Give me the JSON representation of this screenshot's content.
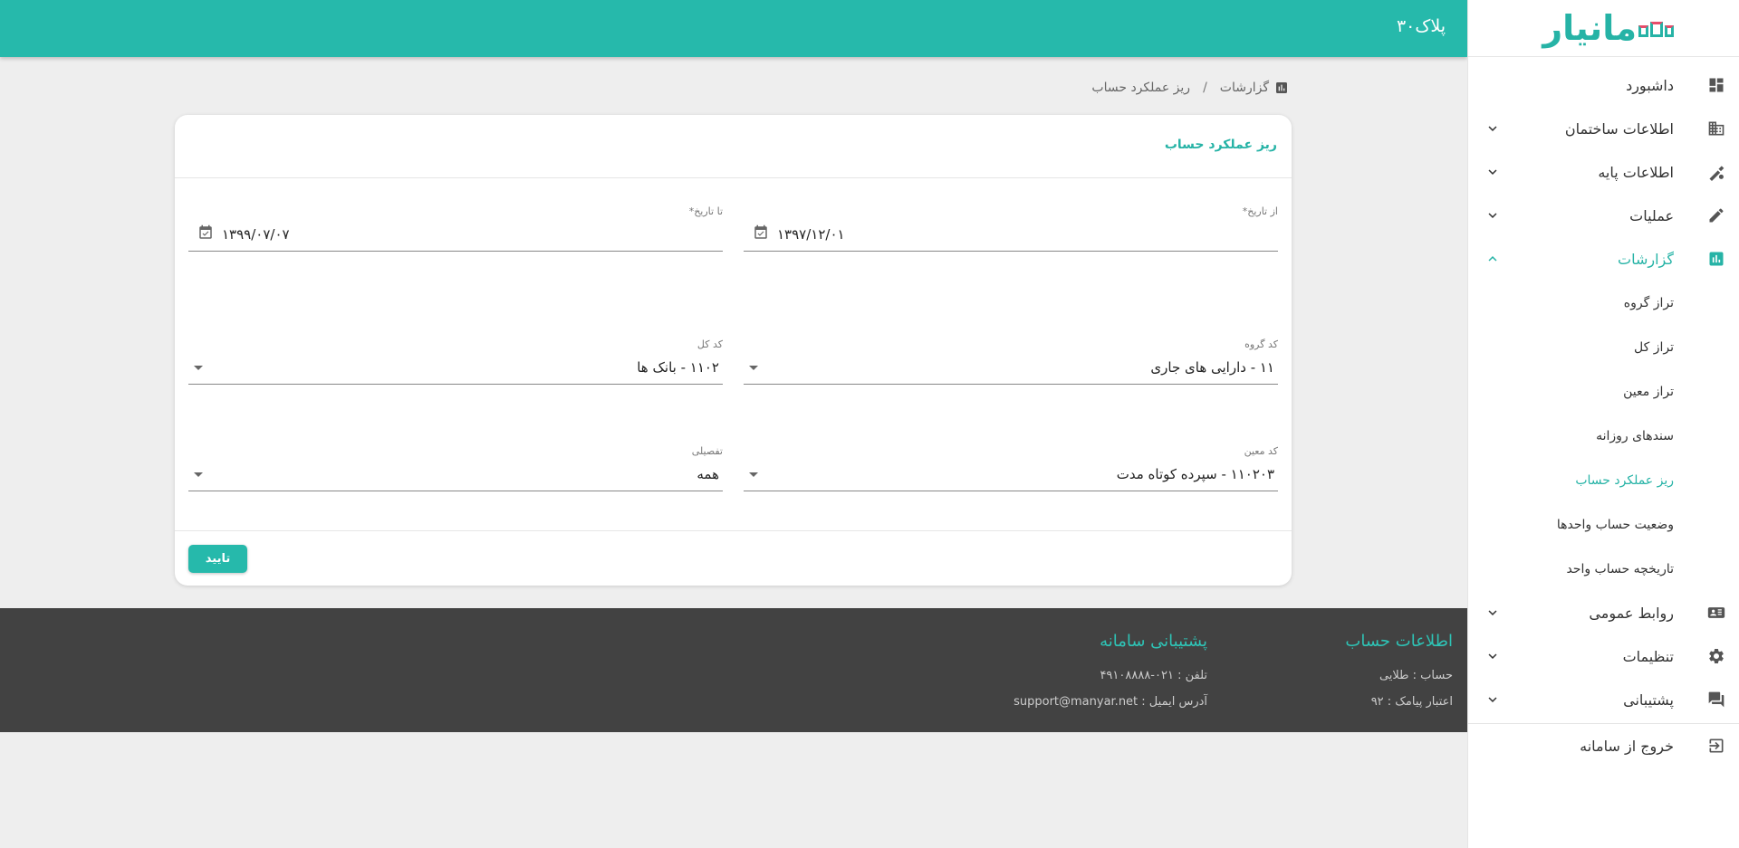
{
  "brand": {
    "logo_text": "مانیار"
  },
  "header": {
    "title": "پلاک۳۰"
  },
  "sidebar": {
    "items": [
      {
        "label": "داشبورد",
        "icon": "dashboard-icon"
      },
      {
        "label": "اطلاعات ساختمان",
        "icon": "building-icon"
      },
      {
        "label": "اطلاعات پایه",
        "icon": "base-info-icon"
      },
      {
        "label": "عملیات",
        "icon": "pencil-icon"
      },
      {
        "label": "گزارشات",
        "icon": "report-icon",
        "expanded": true
      },
      {
        "label": "روابط عمومی",
        "icon": "contact-card-icon"
      },
      {
        "label": "تنظیمات",
        "icon": "gear-icon"
      },
      {
        "label": "پشتیبانی",
        "icon": "chat-icon"
      },
      {
        "label": "خروج از سامانه",
        "icon": "logout-icon"
      }
    ],
    "reports_subitems": [
      "تراز گروه",
      "تراز کل",
      "تراز معین",
      "سندهای روزانه",
      "ریز عملکرد حساب",
      "وضعیت حساب واحدها",
      "تاریخچه حساب واحد"
    ],
    "active_subitem": "ریز عملکرد حساب"
  },
  "breadcrumb": {
    "parent": "گزارشات",
    "separator": "/",
    "current": "ریز عملکرد حساب"
  },
  "form": {
    "title": "ریز عملکرد حساب",
    "from_date": {
      "label": "از تاریخ*",
      "value": "۱۳۹۷/۱۲/۰۱"
    },
    "to_date": {
      "label": "تا تاریخ*",
      "value": "۱۳۹۹/۰۷/۰۷"
    },
    "group_code": {
      "label": "کد گروه",
      "value": "۱۱ - دارایی های جاری"
    },
    "general_code": {
      "label": "کد کل",
      "value": "۱۱۰۲ - بانک ها"
    },
    "specific_code": {
      "label": "کد معین",
      "value": "۱۱۰۲۰۳ - سپرده کوتاه مدت"
    },
    "detail": {
      "label": "تفصیلی",
      "value": "همه"
    },
    "confirm_label": "تایید"
  },
  "footer": {
    "account_title": "اطلاعات حساب",
    "account_lines": [
      "حساب : طلایی",
      "اعتبار پیامک : ۹۲"
    ],
    "support_title": "پشتیبانی سامانه",
    "support_lines": [
      "تلفن : ۰۲۱-۴۹۱۰۸۸۸۸",
      "آدرس ایمیل : support@manyar.net"
    ]
  },
  "colors": {
    "accent": "#26b9ab",
    "footer_bg": "#424242",
    "page_bg": "#eeeeee"
  }
}
